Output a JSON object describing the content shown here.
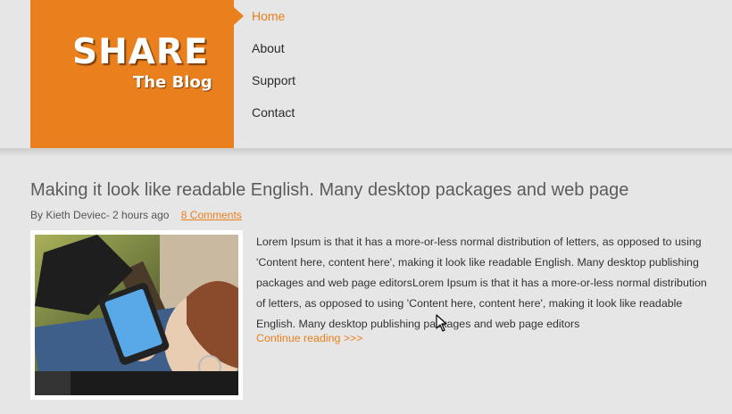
{
  "logo": {
    "title": "SHARE",
    "subtitle": "The Blog"
  },
  "nav": {
    "items": [
      {
        "label": "Home",
        "active": true
      },
      {
        "label": "About",
        "active": false
      },
      {
        "label": "Support",
        "active": false
      },
      {
        "label": "Contact",
        "active": false
      }
    ]
  },
  "post": {
    "title": "Making it look like readable English. Many desktop packages and web page",
    "meta_author": "By Kieth Deviec- 2 hours ago",
    "meta_comments": "8 Comments",
    "body": "Lorem Ipsum is that it has a more-or-less normal distribution of letters, as opposed to using 'Content here, content here', making it look like readable English. Many desktop publishing packages and web page editorsLorem Ipsum is that it has a more-or-less normal distribution of letters, as opposed to using 'Content here, content here', making it look like readable English. Many desktop publishing packages and web page editors",
    "read_more": "Continue reading >>>"
  },
  "colors": {
    "accent": "#ea7f1d",
    "background": "#e6e6e6",
    "text": "#333333"
  }
}
